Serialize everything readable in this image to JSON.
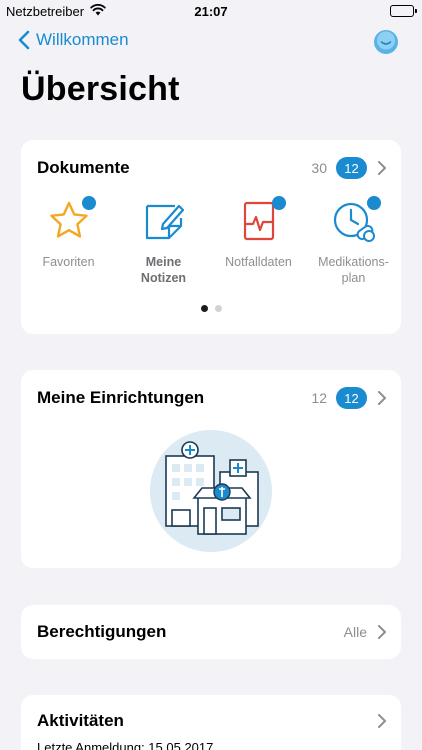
{
  "status_bar": {
    "carrier": "Netzbetreiber",
    "time": "21:07"
  },
  "nav": {
    "back_label": "Willkommen"
  },
  "page_title": "Übersicht",
  "documents": {
    "title": "Dokumente",
    "count": "30",
    "badge": "12",
    "items": [
      {
        "label": "Favoriten",
        "icon": "star-icon",
        "bold": false
      },
      {
        "label": "Meine\nNotizen",
        "icon": "note-icon",
        "bold": true
      },
      {
        "label": "Notfalldaten",
        "icon": "emergency-icon",
        "bold": false
      },
      {
        "label": "Medikations-\nplan",
        "icon": "medication-plan-icon",
        "bold": false
      }
    ]
  },
  "facilities": {
    "title": "Meine Einrichtungen",
    "count": "12",
    "badge": "12"
  },
  "permissions": {
    "title": "Berechtigungen",
    "value": "Alle"
  },
  "activities": {
    "title": "Aktivitäten",
    "subtitle": "Letzte Anmeldung: 15.05.2017"
  },
  "colors": {
    "accent": "#1a8bd0",
    "star": "#f5a623",
    "emergency": "#e0453a",
    "background": "#f2f2f7"
  }
}
